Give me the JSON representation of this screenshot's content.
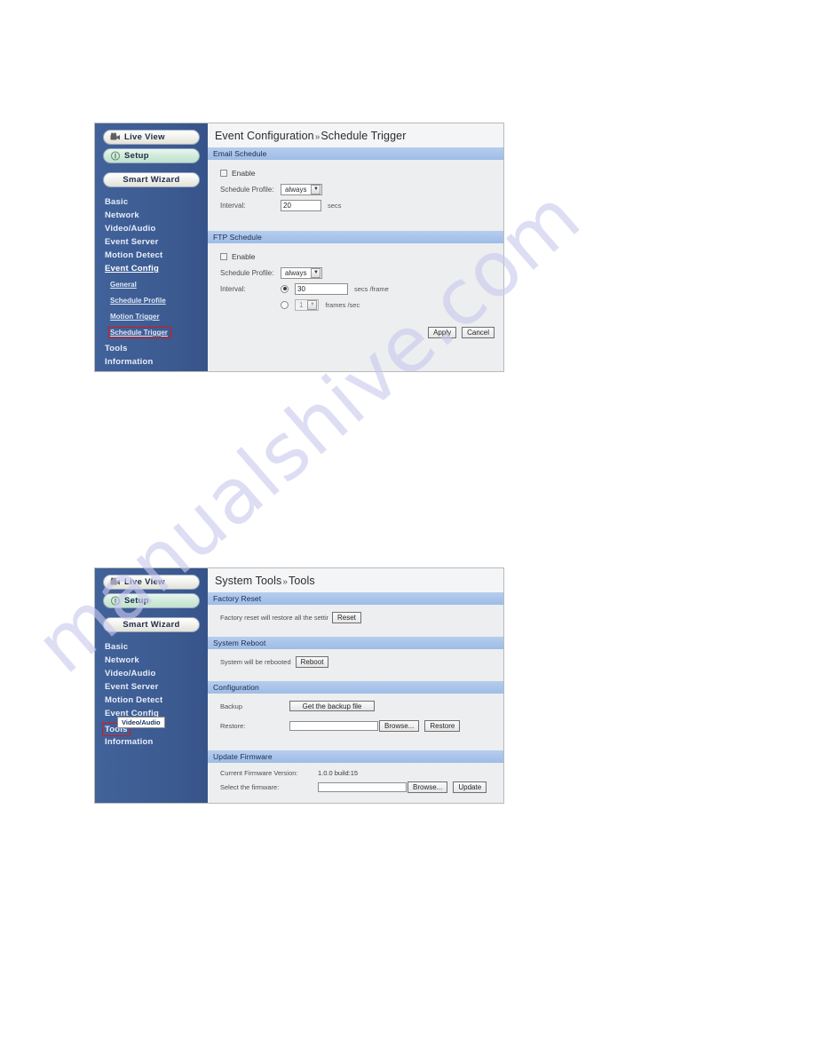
{
  "watermark": {
    "text": "manualshive.com"
  },
  "screens": [
    {
      "id": "schedule-trigger",
      "sidebar": {
        "live_view": "Live View",
        "setup": "Setup",
        "smart_wizard": "Smart Wizard",
        "items": [
          {
            "label": "Basic",
            "active": false
          },
          {
            "label": "Network",
            "active": false
          },
          {
            "label": "Video/Audio",
            "active": false
          },
          {
            "label": "Event Server",
            "active": false
          },
          {
            "label": "Motion Detect",
            "active": false
          },
          {
            "label": "Event Config",
            "active": true
          },
          {
            "label": "Tools",
            "active": false
          },
          {
            "label": "Information",
            "active": false
          }
        ],
        "subitems": [
          {
            "label": "General",
            "highlighted": false
          },
          {
            "label": "Schedule Profile",
            "highlighted": false
          },
          {
            "label": "Motion Trigger",
            "highlighted": false
          },
          {
            "label": "Schedule Trigger",
            "highlighted": true
          }
        ]
      },
      "title": {
        "main": "Event Configuration",
        "sep": "»",
        "sub": "Schedule Trigger"
      },
      "email_section": {
        "header": "Email Schedule",
        "enable_label": "Enable",
        "enable_checked": false,
        "profile_label": "Schedule Profile:",
        "profile_value": "always",
        "profile_options": [
          "always"
        ],
        "interval_label": "Interval:",
        "interval_value": "20",
        "interval_unit": "secs"
      },
      "ftp_section": {
        "header": "FTP Schedule",
        "enable_label": "Enable",
        "enable_checked": false,
        "profile_label": "Schedule Profile:",
        "profile_value": "always",
        "profile_options": [
          "always"
        ],
        "interval_label": "Interval:",
        "secs_per_frame_value": "30",
        "secs_per_frame_unit": "secs /frame",
        "secs_per_frame_selected": true,
        "frames_per_sec_value": "1",
        "frames_per_sec_unit": "frames /sec",
        "frames_per_sec_selected": false
      },
      "buttons": {
        "apply": "Apply",
        "cancel": "Cancel"
      }
    },
    {
      "id": "system-tools",
      "sidebar": {
        "live_view": "Live View",
        "setup": "Setup",
        "smart_wizard": "Smart Wizard",
        "items": [
          {
            "label": "Basic",
            "active": false
          },
          {
            "label": "Network",
            "active": false
          },
          {
            "label": "Video/Audio",
            "active": false
          },
          {
            "label": "Event Server",
            "active": false
          },
          {
            "label": "Motion Detect",
            "active": false
          },
          {
            "label": "Event Config",
            "active": false
          },
          {
            "label": "Tools",
            "active": true,
            "highlighted": true
          },
          {
            "label": "Information",
            "active": false
          }
        ],
        "tooltip": "Video/Audio"
      },
      "title": {
        "main": "System Tools",
        "sep": "»",
        "sub": "Tools"
      },
      "factory_reset": {
        "header": "Factory Reset",
        "description": "Factory reset will restore all the setting",
        "button": "Reset"
      },
      "system_reboot": {
        "header": "System Reboot",
        "description": "System will be rebooted",
        "button": "Reboot"
      },
      "configuration": {
        "header": "Configuration",
        "backup_label": "Backup",
        "backup_button": "Get the backup file",
        "restore_label": "Restore:",
        "restore_input_value": "",
        "browse_button": "Browse...",
        "restore_button": "Restore"
      },
      "update_firmware": {
        "header": "Update Firmware",
        "current_version_label": "Current Firmware Version:",
        "current_version_value": "1.0.0 build:15",
        "select_label": "Select the firmware:",
        "select_input_value": "",
        "browse_button": "Browse...",
        "update_button": "Update"
      }
    }
  ]
}
